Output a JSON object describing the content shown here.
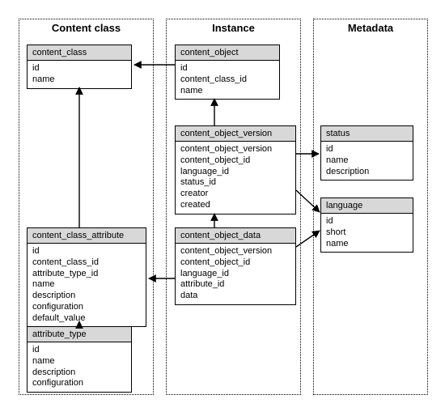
{
  "zones": {
    "content_class": {
      "title": "Content class"
    },
    "instance": {
      "title": "Instance"
    },
    "metadata": {
      "title": "Metadata"
    }
  },
  "entities": {
    "content_class": {
      "name": "content_class",
      "fields": [
        "id",
        "name"
      ]
    },
    "content_class_attribute": {
      "name": "content_class_attribute",
      "fields": [
        "id",
        "content_class_id",
        "attribute_type_id",
        "name",
        "description",
        "configuration",
        "default_value"
      ]
    },
    "attribute_type": {
      "name": "attribute_type",
      "fields": [
        "id",
        "name",
        "description",
        "configuration"
      ]
    },
    "content_object": {
      "name": "content_object",
      "fields": [
        "id",
        "content_class_id",
        "name"
      ]
    },
    "content_object_version": {
      "name": "content_object_version",
      "fields": [
        "content_object_version",
        "content_object_id",
        "language_id",
        "status_id",
        "creator",
        "created"
      ]
    },
    "content_object_data": {
      "name": "content_object_data",
      "fields": [
        "content_object_version",
        "content_object_id",
        "language_id",
        "attribute_id",
        "data"
      ]
    },
    "status": {
      "name": "status",
      "fields": [
        "id",
        "name",
        "description"
      ]
    },
    "language": {
      "name": "language",
      "fields": [
        "id",
        "short",
        "name"
      ]
    }
  }
}
